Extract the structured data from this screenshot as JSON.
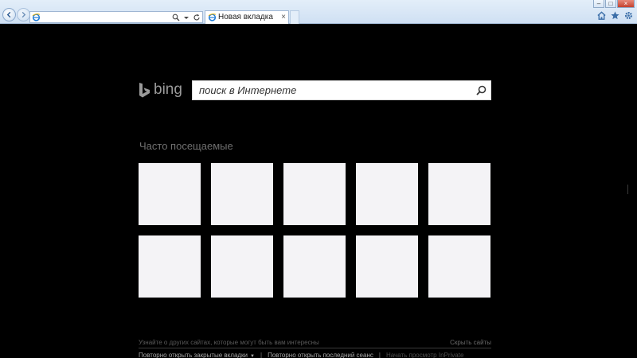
{
  "browser": {
    "address_value": "",
    "tab_title": "Новая вкладка",
    "tab_close": "×",
    "window_buttons": {
      "minimize": "–",
      "maximize": "□",
      "close": "×"
    },
    "icons": [
      "back-icon",
      "forward-icon",
      "ie-icon",
      "search-icon",
      "refresh-icon",
      "home-icon",
      "star-icon",
      "gear-icon"
    ]
  },
  "bing": {
    "logo_text": "bing",
    "search_placeholder": "поиск в Интернете"
  },
  "frequent": {
    "title": "Часто посещаемые",
    "tiles": [
      "",
      "",
      "",
      "",
      "",
      "",
      "",
      "",
      "",
      ""
    ]
  },
  "footer": {
    "hint": "Узнайте о других сайтах, которые могут быть вам интересны",
    "hide_sites": "Скрыть сайты",
    "reopen_closed_tabs": "Повторно открыть закрытые вкладки",
    "separator": "|",
    "reopen_last_session": "Повторно открыть последний сеанс",
    "start_inprivate": "Начать просмотр InPrivate"
  },
  "colors": {
    "page_bg": "#000000",
    "tile_bg": "#f4f3f6",
    "chrome_bg": "#dce9f7"
  }
}
